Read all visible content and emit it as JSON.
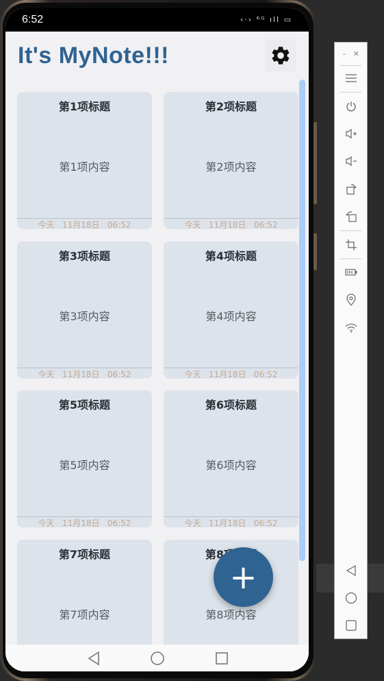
{
  "status_bar": {
    "time": "6:52",
    "icons": "‹·› ⁶ᴳ ıll ▭"
  },
  "app": {
    "title": "It's MyNote!!!",
    "notes": [
      {
        "title": "第1项标题",
        "content": "第1项内容",
        "footer": "今天   11月18日   06:52"
      },
      {
        "title": "第2项标题",
        "content": "第2项内容",
        "footer": "今天   11月18日   06:52"
      },
      {
        "title": "第3项标题",
        "content": "第3项内容",
        "footer": "今天   11月18日   06:52"
      },
      {
        "title": "第4项标题",
        "content": "第4项内容",
        "footer": "今天   11月18日   06:52"
      },
      {
        "title": "第5项标题",
        "content": "第5项内容",
        "footer": "今天   11月18日   06:52"
      },
      {
        "title": "第6项标题",
        "content": "第6项内容",
        "footer": "今天   11月18日   06:52"
      },
      {
        "title": "第7项标题",
        "content": "第7项内容",
        "footer": ""
      },
      {
        "title": "第8项标题",
        "content": "第8项内容",
        "footer": ""
      }
    ],
    "fab_label": "+",
    "accent_color": "#2f6392",
    "card_color": "#dde3eb"
  },
  "navbar": {
    "icons": [
      "back-icon",
      "home-icon",
      "recents-icon"
    ]
  },
  "toolbar": {
    "icons": [
      "minimize-icon",
      "close-icon",
      "menu-icon",
      "power-icon",
      "volume-up-icon",
      "volume-down-icon",
      "rotate-right-icon",
      "rotate-left-icon",
      "screenshot-crop-icon",
      "battery-icon",
      "location-icon",
      "wifi-icon",
      "back-icon",
      "home-icon",
      "recents-icon"
    ]
  }
}
